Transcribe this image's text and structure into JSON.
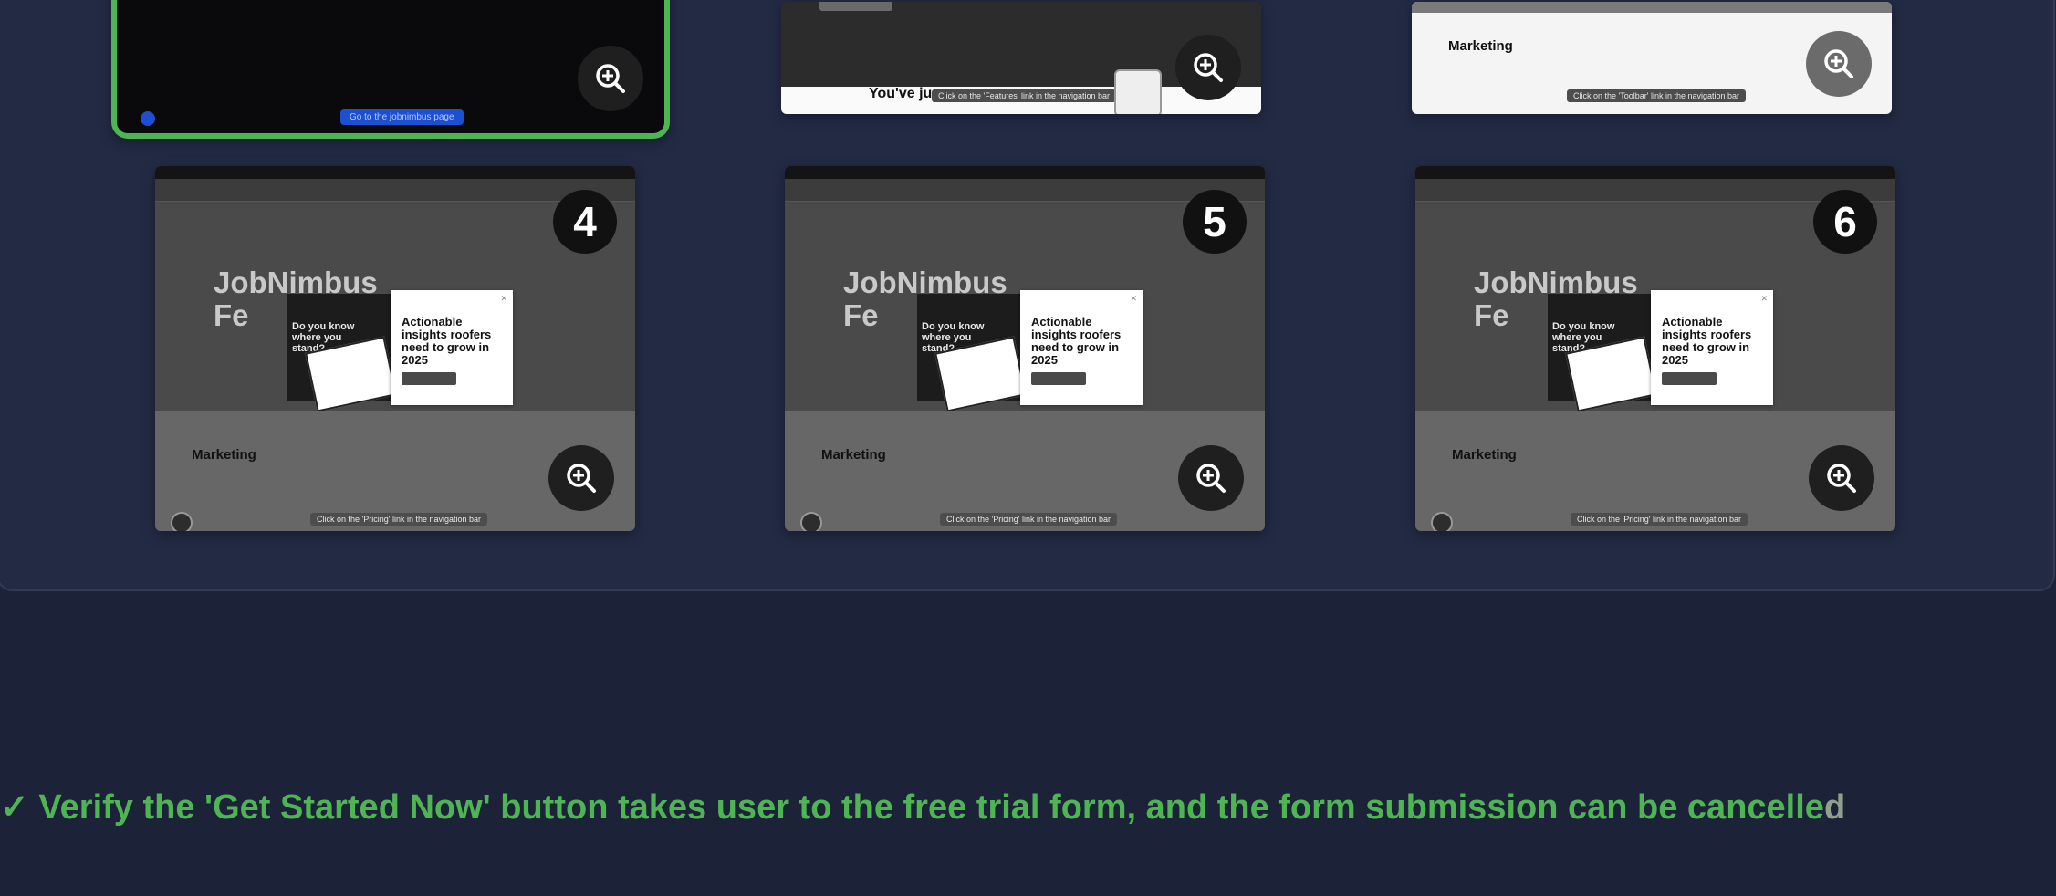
{
  "thumbnails": [
    {
      "id": 1,
      "goto_label": "Go to the jobnimbus page"
    },
    {
      "id": 2,
      "heading": "You've ju",
      "tooltip": "Click on the 'Features' link in the navigation bar"
    },
    {
      "id": 3,
      "section": "Marketing",
      "tooltip": "Click on the 'Toolbar' link in the navigation bar"
    },
    {
      "id": 4,
      "badge": "4",
      "hero_title_line1": "JobNimbus",
      "hero_title_line2": "Fe",
      "promo_question": "Do you know where you stand?",
      "card_title": "Actionable insights roofers need to grow in 2025",
      "section": "Marketing",
      "tooltip": "Click on the 'Pricing' link in the navigation bar"
    },
    {
      "id": 5,
      "badge": "5",
      "hero_title_line1": "JobNimbus",
      "hero_title_line2": "Fe",
      "promo_question": "Do you know where you stand?",
      "card_title": "Actionable insights roofers need to grow in 2025",
      "section": "Marketing",
      "tooltip": "Click on the 'Pricing' link in the navigation bar"
    },
    {
      "id": 6,
      "badge": "6",
      "hero_title_line1": "JobNimbus",
      "hero_title_line2": "Fe",
      "promo_question": "Do you know where you stand?",
      "card_title": "Actionable insights roofers need to grow in 2025",
      "section": "Marketing",
      "tooltip": "Click on the 'Pricing' link in the navigation bar"
    }
  ],
  "verify": {
    "check": "✓",
    "text": "Verify the 'Get Started Now' button takes user to the free trial form, and the form submission can be cancelle",
    "tail": "d"
  },
  "icons": {
    "zoom": "zoom-in-icon",
    "check": "checkmark-icon"
  },
  "colors": {
    "background": "#1c2238",
    "panel": "#232a44",
    "selected_border": "#4fb454",
    "success_text": "#4fb454"
  }
}
